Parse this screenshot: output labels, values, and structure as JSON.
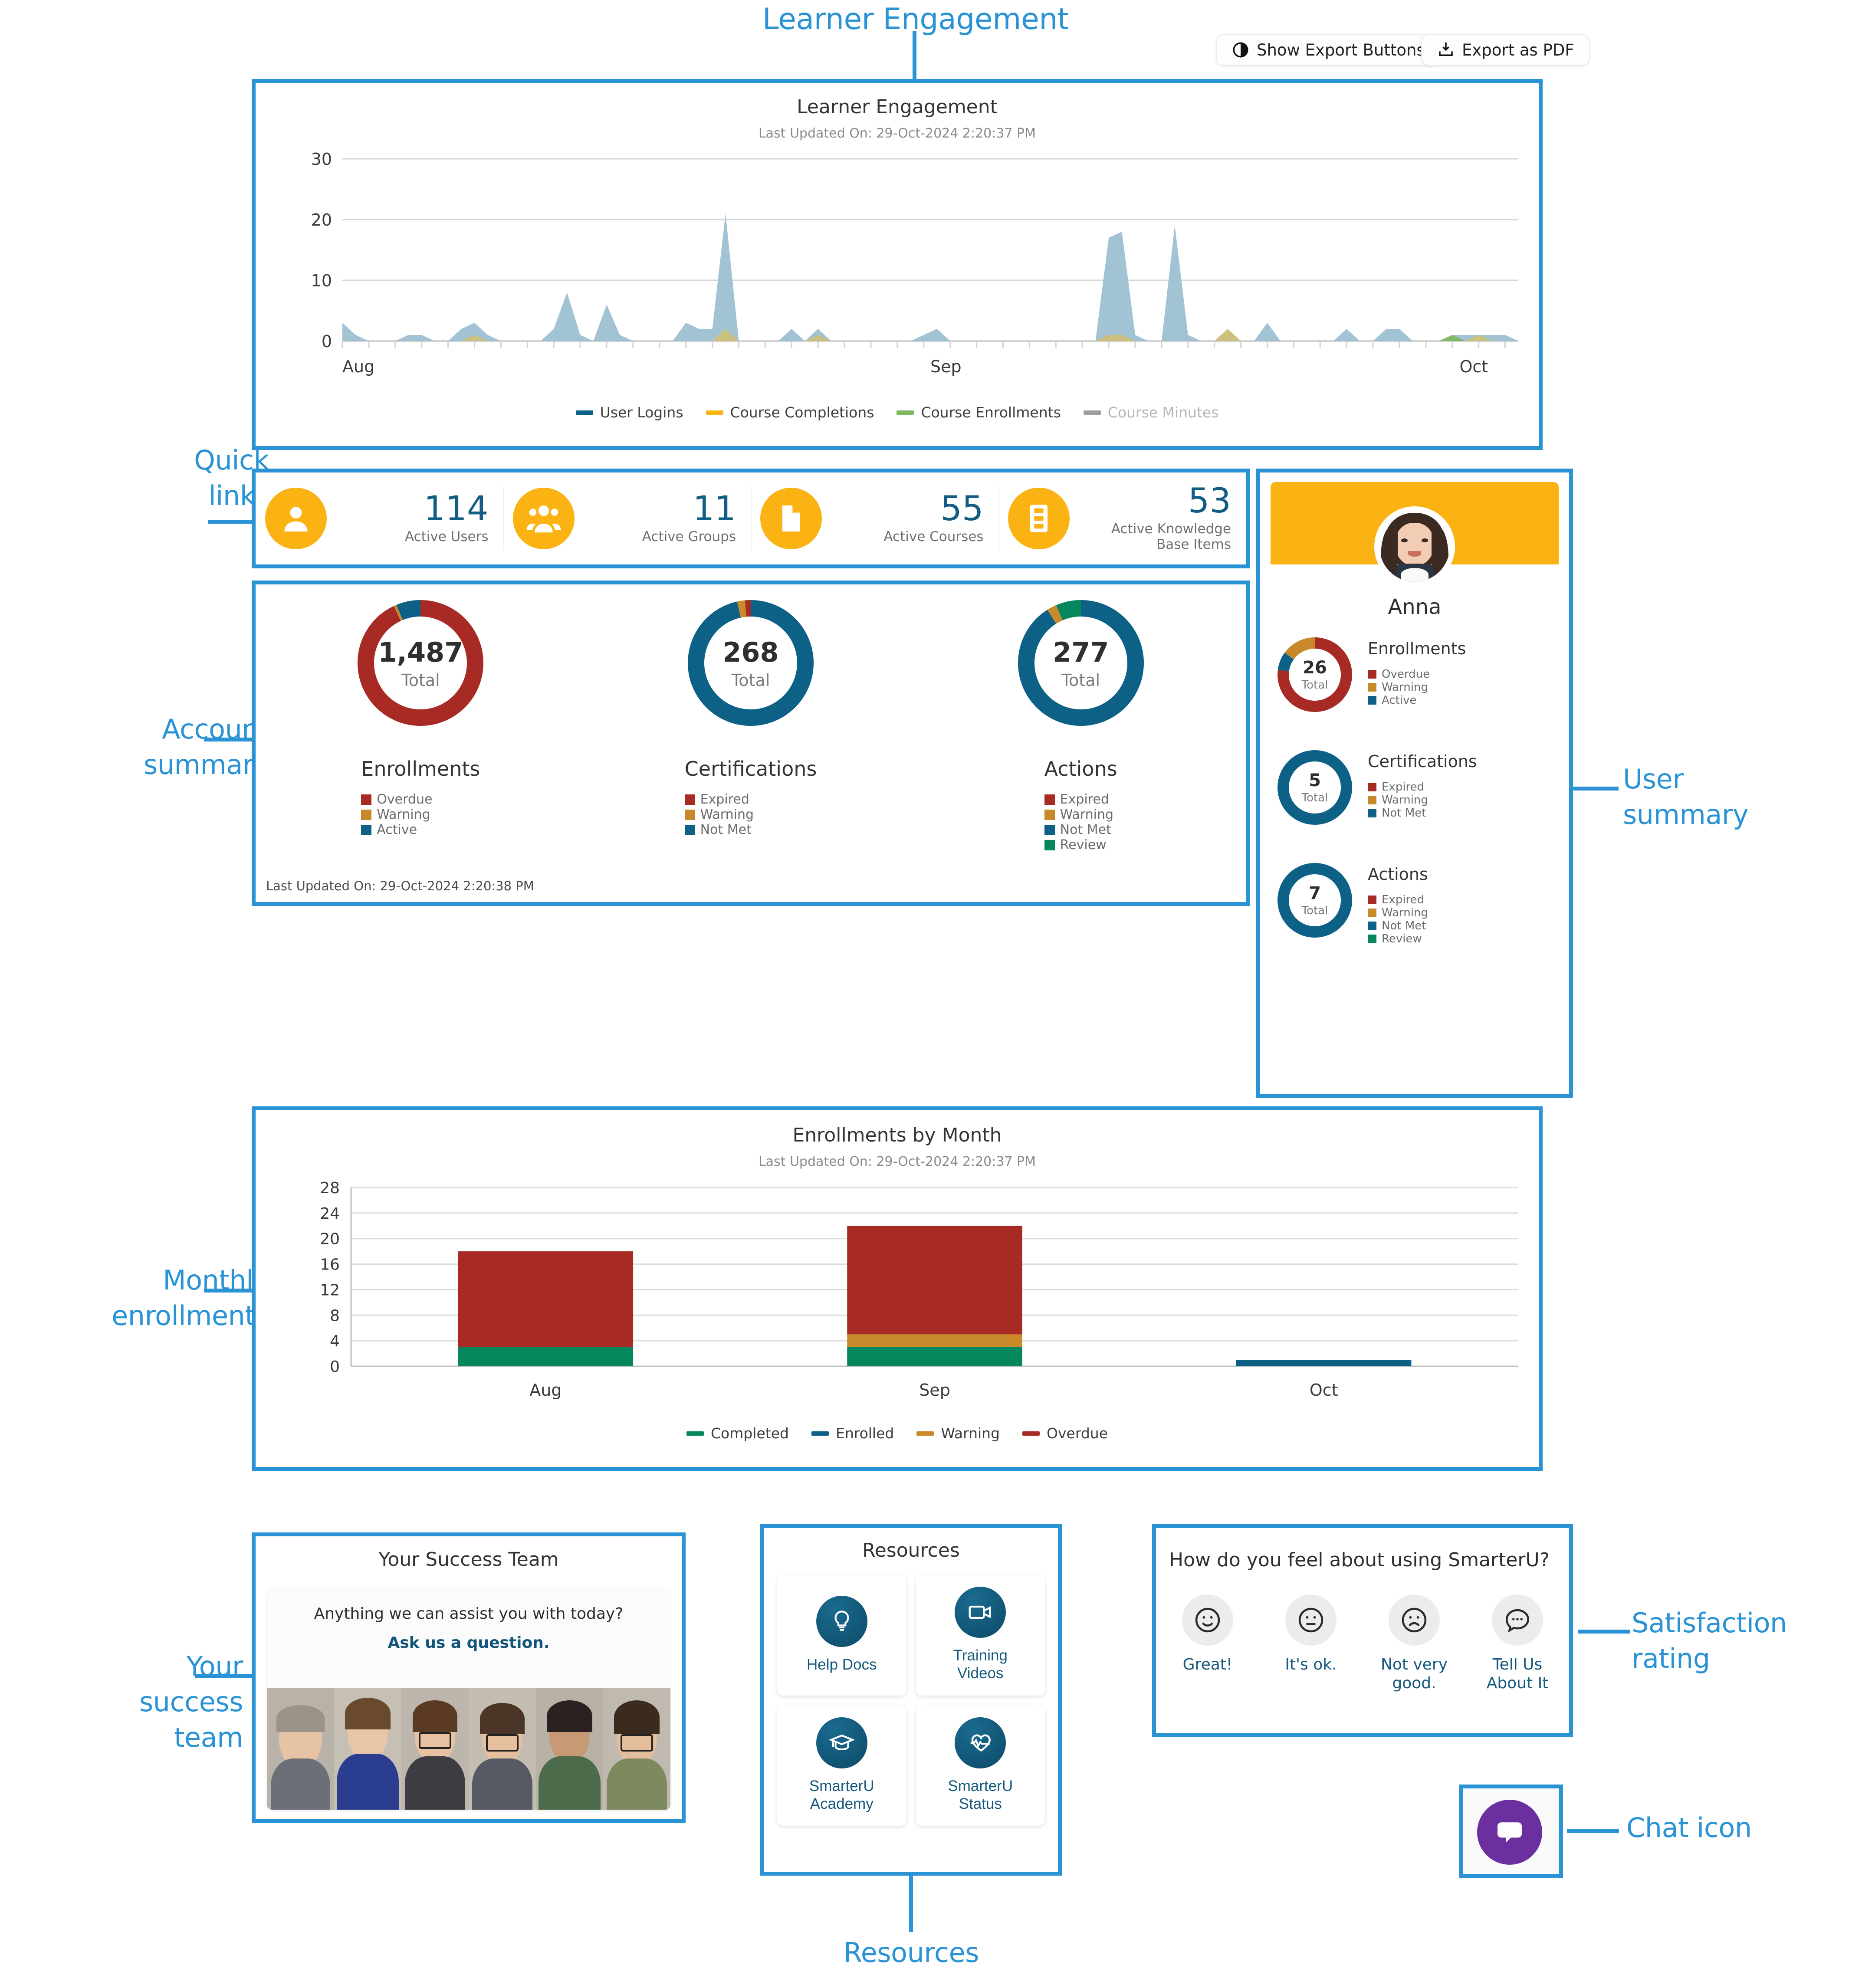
{
  "colors": {
    "annotation_blue": "#2a93d5",
    "brand_yellow": "#fbb313",
    "teal": "#0d6186",
    "red": "#a82a24",
    "gold": "#c8892a",
    "green": "#05865d",
    "area_blue": "#9cc0d1",
    "area_gold": "#cfc07a",
    "chat_purple": "#6b2fa0"
  },
  "annotations": [
    {
      "name": "learner-engagement",
      "text": "Learner Engagement"
    },
    {
      "name": "quick-links",
      "text": "Quick\nlinks"
    },
    {
      "name": "account-summary",
      "text": "Account\nsummary"
    },
    {
      "name": "user-summary",
      "text": "User\nsummary"
    },
    {
      "name": "monthly-enrollments",
      "text": "Monthly\nenrollments"
    },
    {
      "name": "your-success-team",
      "text": "Your\nsuccess\nteam"
    },
    {
      "name": "resources",
      "text": "Resources"
    },
    {
      "name": "satisfaction-rating",
      "text": "Satisfaction\nrating"
    },
    {
      "name": "chat-icon",
      "text": "Chat icon"
    }
  ],
  "toolbar": {
    "show_export_label": "Show Export Buttons",
    "export_pdf_label": "Export as PDF"
  },
  "learner_engagement": {
    "title": "Learner Engagement",
    "last_updated": "Last Updated On: 29-Oct-2024 2:20:37 PM"
  },
  "quick_links": [
    {
      "icon": "user-icon",
      "value": "114",
      "label": "Active Users"
    },
    {
      "icon": "users-group-icon",
      "value": "11",
      "label": "Active Groups"
    },
    {
      "icon": "folder-icon",
      "value": "55",
      "label": "Active Courses"
    },
    {
      "icon": "book-icon",
      "value": "53",
      "label": "Active Knowledge\nBase Items"
    }
  ],
  "account_summary": {
    "last_updated": "Last Updated On: 29-Oct-2024 2:20:38 PM",
    "donuts": [
      {
        "title": "Enrollments",
        "total": "1,487",
        "total_label": "Total",
        "legend": [
          {
            "label": "Overdue",
            "color": "#a82a24"
          },
          {
            "label": "Warning",
            "color": "#c8892a"
          },
          {
            "label": "Active",
            "color": "#0d6186"
          }
        ],
        "segments": [
          {
            "label": "Overdue",
            "color": "#a82a24",
            "pct": 93.0
          },
          {
            "label": "Warning",
            "color": "#c8892a",
            "pct": 0.7
          },
          {
            "label": "Active",
            "color": "#0d6186",
            "pct": 6.3
          }
        ]
      },
      {
        "title": "Certifications",
        "total": "268",
        "total_label": "Total",
        "legend": [
          {
            "label": "Expired",
            "color": "#a82a24"
          },
          {
            "label": "Warning",
            "color": "#c8892a"
          },
          {
            "label": "Not Met",
            "color": "#0d6186"
          }
        ],
        "segments": [
          {
            "label": "Not Met",
            "color": "#0d6186",
            "pct": 96.5
          },
          {
            "label": "Warning",
            "color": "#c8892a",
            "pct": 2.0
          },
          {
            "label": "Expired",
            "color": "#a82a24",
            "pct": 1.5
          }
        ]
      },
      {
        "title": "Actions",
        "total": "277",
        "total_label": "Total",
        "legend": [
          {
            "label": "Expired",
            "color": "#a82a24"
          },
          {
            "label": "Warning",
            "color": "#c8892a"
          },
          {
            "label": "Not Met",
            "color": "#0d6186"
          },
          {
            "label": "Review",
            "color": "#05865d"
          }
        ],
        "segments": [
          {
            "label": "Not Met",
            "color": "#0d6186",
            "pct": 91.0
          },
          {
            "label": "Warning",
            "color": "#c8892a",
            "pct": 2.5
          },
          {
            "label": "Review",
            "color": "#05865d",
            "pct": 6.5
          }
        ]
      }
    ]
  },
  "user_summary": {
    "name": "Anna",
    "avatar": "user-photo",
    "donuts": [
      {
        "title": "Enrollments",
        "total": "26",
        "total_label": "Total",
        "legend": [
          {
            "label": "Overdue",
            "color": "#a82a24"
          },
          {
            "label": "Warning",
            "color": "#c8892a"
          },
          {
            "label": "Active",
            "color": "#0d6186"
          }
        ],
        "segments": [
          {
            "label": "Overdue",
            "color": "#a82a24",
            "pct": 77
          },
          {
            "label": "Active",
            "color": "#0d6186",
            "pct": 8
          },
          {
            "label": "Warning",
            "color": "#c8892a",
            "pct": 15
          }
        ]
      },
      {
        "title": "Certifications",
        "total": "5",
        "total_label": "Total",
        "legend": [
          {
            "label": "Expired",
            "color": "#a82a24"
          },
          {
            "label": "Warning",
            "color": "#c8892a"
          },
          {
            "label": "Not Met",
            "color": "#0d6186"
          }
        ],
        "segments": [
          {
            "label": "Not Met",
            "color": "#0d6186",
            "pct": 100
          }
        ]
      },
      {
        "title": "Actions",
        "total": "7",
        "total_label": "Total",
        "legend": [
          {
            "label": "Expired",
            "color": "#a82a24"
          },
          {
            "label": "Warning",
            "color": "#c8892a"
          },
          {
            "label": "Not Met",
            "color": "#0d6186"
          },
          {
            "label": "Review",
            "color": "#05865d"
          }
        ],
        "segments": [
          {
            "label": "Not Met",
            "color": "#0d6186",
            "pct": 100
          }
        ]
      }
    ]
  },
  "enrollments_by_month": {
    "title": "Enrollments by Month",
    "last_updated": "Last Updated On: 29-Oct-2024 2:20:37 PM"
  },
  "success_team": {
    "title": "Your Success Team",
    "question": "Anything we can assist you with today?",
    "cta": "Ask us a question."
  },
  "resources": {
    "title": "Resources",
    "tiles": [
      {
        "icon": "lightbulb-icon",
        "label": "Help Docs"
      },
      {
        "icon": "video-camera-icon",
        "label": "Training\nVideos"
      },
      {
        "icon": "graduation-cap-icon",
        "label": "SmarterU\nAcademy"
      },
      {
        "icon": "heartbeat-icon",
        "label": "SmarterU\nStatus"
      }
    ]
  },
  "satisfaction": {
    "question": "How do you feel about using SmarterU?",
    "options": [
      {
        "icon": "smiley-happy-icon",
        "label": "Great!"
      },
      {
        "icon": "smiley-neutral-icon",
        "label": "It's ok."
      },
      {
        "icon": "smiley-sad-icon",
        "label": "Not very\ngood."
      },
      {
        "icon": "chat-bubble-icon",
        "label": "Tell Us\nAbout It"
      }
    ]
  },
  "chart_data": [
    {
      "type": "area",
      "name": "learner-engagement-chart",
      "title": "Learner Engagement",
      "subtitle": "Last Updated On: 29-Oct-2024 2:20:37 PM",
      "xlabel": "",
      "ylabel": "",
      "ylim": [
        0,
        30
      ],
      "yticks": [
        0,
        10,
        20,
        30
      ],
      "xticks": [
        "Aug",
        "Sep",
        "Oct"
      ],
      "grid": true,
      "legend_position": "bottom",
      "legend": [
        {
          "name": "User Logins",
          "color": "#0d6186",
          "dimmed": false
        },
        {
          "name": "Course Completions",
          "color": "#fbb313",
          "dimmed": false
        },
        {
          "name": "Course Enrollments",
          "color": "#7db85c",
          "dimmed": false
        },
        {
          "name": "Course Minutes",
          "color": "#9e9e9e",
          "dimmed": true
        }
      ],
      "x": [
        1,
        2,
        3,
        4,
        5,
        6,
        7,
        8,
        9,
        10,
        11,
        12,
        13,
        14,
        15,
        16,
        17,
        18,
        19,
        20,
        21,
        22,
        23,
        24,
        25,
        26,
        27,
        28,
        29,
        30,
        31,
        32,
        33,
        34,
        35,
        36,
        37,
        38,
        39,
        40,
        41,
        42,
        43,
        44,
        45,
        46,
        47,
        48,
        49,
        50,
        51,
        52,
        53,
        54,
        55,
        56,
        57,
        58,
        59,
        60,
        61,
        62,
        63,
        64,
        65,
        66,
        67,
        68,
        69,
        70,
        71,
        72,
        73,
        74,
        75,
        76,
        77,
        78,
        79,
        80,
        81,
        82,
        83,
        84,
        85,
        86,
        87,
        88,
        89,
        90
      ],
      "series": [
        {
          "name": "User Logins",
          "color": "#9cc0d1",
          "values": [
            3,
            1,
            0,
            0,
            0,
            1,
            1,
            0,
            0,
            2,
            3,
            1,
            0,
            0,
            0,
            0,
            2,
            8,
            1,
            0,
            6,
            1,
            0,
            0,
            0,
            0,
            3,
            2,
            2,
            21,
            0,
            0,
            0,
            0,
            2,
            0,
            2,
            0,
            0,
            0,
            0,
            0,
            0,
            0,
            1,
            2,
            0,
            0,
            0,
            0,
            0,
            0,
            0,
            0,
            0,
            0,
            0,
            0,
            17,
            18,
            1,
            0,
            0,
            19,
            1,
            0,
            0,
            2,
            0,
            0,
            3,
            0,
            0,
            0,
            0,
            0,
            2,
            0,
            0,
            2,
            2,
            0,
            0,
            0,
            1,
            1,
            1,
            1,
            1,
            0
          ]
        },
        {
          "name": "Course Completions",
          "color": "#cfc07a",
          "values": [
            0,
            0,
            0,
            0,
            0,
            0,
            0,
            0,
            0,
            0,
            1,
            0,
            0,
            0,
            0,
            0,
            0,
            0,
            0,
            0,
            0,
            0,
            0,
            0,
            0,
            0,
            0,
            0,
            0,
            2,
            0,
            0,
            0,
            0,
            0,
            0,
            1,
            0,
            0,
            0,
            0,
            0,
            0,
            0,
            0,
            0,
            0,
            0,
            0,
            0,
            0,
            0,
            0,
            0,
            0,
            0,
            0,
            0,
            1,
            1,
            0,
            0,
            0,
            0,
            0,
            0,
            0,
            2,
            0,
            0,
            0,
            0,
            0,
            0,
            0,
            0,
            0,
            0,
            0,
            0,
            0,
            0,
            0,
            0,
            0,
            0,
            1,
            0,
            0,
            0
          ]
        },
        {
          "name": "Course Enrollments",
          "color": "#7db85c",
          "values": [
            0,
            0,
            0,
            0,
            0,
            0,
            0,
            0,
            0,
            0,
            0,
            0,
            0,
            0,
            0,
            0,
            0,
            0,
            0,
            0,
            0,
            0,
            0,
            0,
            0,
            0,
            0,
            0,
            0,
            0,
            0,
            0,
            0,
            0,
            0,
            0,
            0,
            0,
            0,
            0,
            0,
            0,
            0,
            0,
            0,
            0,
            0,
            0,
            0,
            0,
            0,
            0,
            0,
            0,
            0,
            0,
            0,
            0,
            0,
            0,
            0,
            0,
            0,
            0,
            0,
            0,
            0,
            0,
            0,
            0,
            0,
            0,
            0,
            0,
            0,
            0,
            0,
            0,
            0,
            0,
            0,
            0,
            0,
            0,
            1,
            0,
            0,
            0,
            0,
            0
          ]
        }
      ]
    },
    {
      "type": "bar",
      "name": "enrollments-by-month-chart",
      "title": "Enrollments by Month",
      "subtitle": "Last Updated On: 29-Oct-2024 2:20:37 PM",
      "stacked": true,
      "categories": [
        "Aug",
        "Sep",
        "Oct"
      ],
      "xlabel": "",
      "ylabel": "",
      "ylim": [
        0,
        28
      ],
      "yticks": [
        0,
        4,
        8,
        12,
        16,
        20,
        24,
        28
      ],
      "grid": true,
      "legend_position": "bottom",
      "series": [
        {
          "name": "Completed",
          "color": "#05865d",
          "values": [
            3,
            3,
            0
          ]
        },
        {
          "name": "Enrolled",
          "color": "#0d6186",
          "values": [
            0,
            0,
            1
          ]
        },
        {
          "name": "Warning",
          "color": "#c8892a",
          "values": [
            0,
            2,
            0
          ]
        },
        {
          "name": "Overdue",
          "color": "#a82a24",
          "values": [
            15,
            17,
            0
          ]
        }
      ],
      "totals": [
        18,
        22,
        1
      ]
    }
  ]
}
